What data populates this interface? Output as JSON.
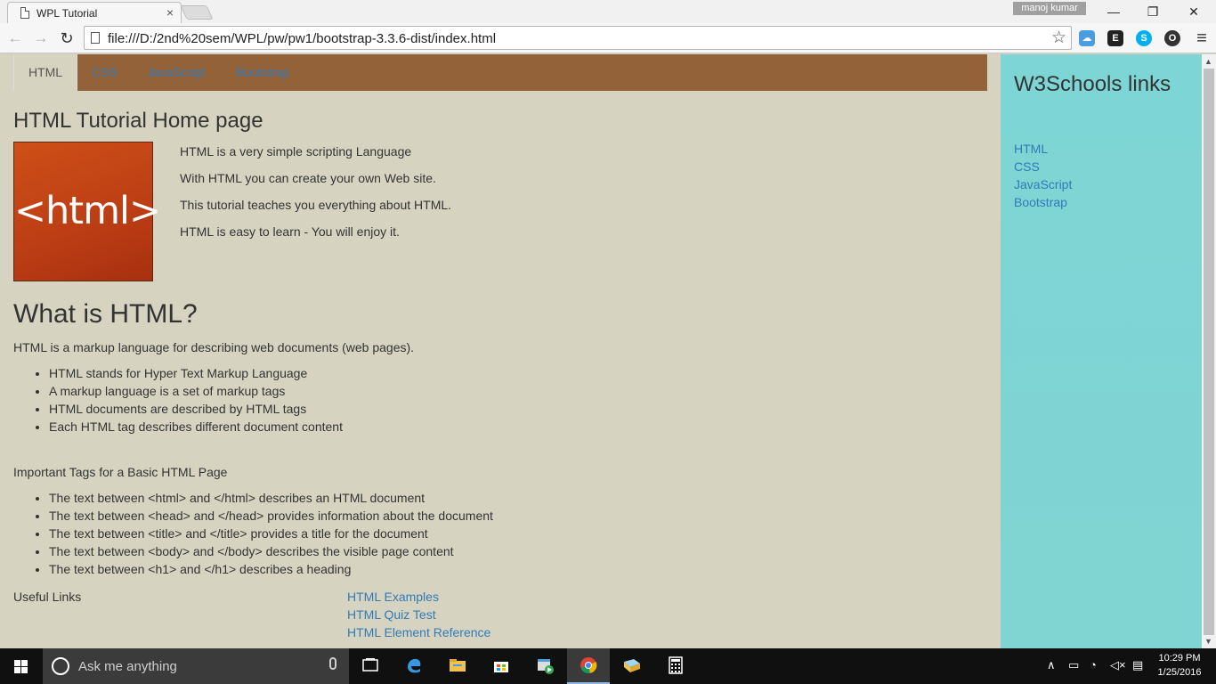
{
  "browser": {
    "tab_title": "WPL Tutorial",
    "tab_close": "×",
    "profile_name": "manoj kumar",
    "window_controls": {
      "minimize": "—",
      "restore": "❐",
      "close": "✕"
    },
    "back_icon": "←",
    "forward_icon": "→",
    "reload_icon": "↻",
    "url": "file:///D:/2nd%20sem/WPL/pw/pw1/bootstrap-3.3.6-dist/index.html",
    "star_icon": "☆",
    "menu_icon": "≡",
    "extensions": [
      "cloud-icon",
      "evernote-icon",
      "skype-icon",
      "opera-icon"
    ]
  },
  "nav": {
    "tabs": [
      {
        "label": "HTML",
        "active": true
      },
      {
        "label": "CSS",
        "active": false
      },
      {
        "label": "JavaScript",
        "active": false
      },
      {
        "label": "Bootstrap",
        "active": false
      }
    ]
  },
  "main": {
    "title": "HTML Tutorial Home page",
    "logo_text": "<html>",
    "intro": [
      "HTML is a very simple scripting Language",
      "With HTML you can create your own Web site.",
      "This tutorial teaches you everything about HTML.",
      "HTML is easy to learn - You will enjoy it."
    ],
    "whatis_heading": "What is HTML?",
    "whatis_para": "HTML is a markup language for describing web documents (web pages).",
    "whatis_list": [
      "HTML stands for Hyper Text Markup Language",
      "A markup language is a set of markup tags",
      "HTML documents are described by HTML tags",
      "Each HTML tag describes different document content"
    ],
    "tags_heading": "Important Tags for a Basic HTML Page",
    "tags_list": [
      "The text between <html> and </html> describes an HTML document",
      "The text between <head> and </head> provides information about the document",
      "The text between <title> and </title> provides a title for the document",
      "The text between <body> and </body> describes the visible page content",
      "The text between <h1> and </h1> describes a heading"
    ],
    "useful_label": "Useful Links",
    "useful_links": [
      "HTML Examples",
      "HTML Quiz Test",
      "HTML Element Reference"
    ]
  },
  "sidebar": {
    "title": "W3Schools links",
    "links": [
      "HTML",
      "CSS",
      "JavaScript",
      "Bootstrap"
    ]
  },
  "taskbar": {
    "search_placeholder": "Ask me anything",
    "apps": [
      "task-view-icon",
      "edge-icon",
      "file-explorer-icon",
      "store-icon",
      "media-icon",
      "chrome-icon",
      "folder-icon",
      "calculator-icon"
    ],
    "time": "10:29 PM",
    "date": "1/25/2016"
  },
  "colors": {
    "page_bg": "#d6d4c1",
    "navbar_bg": "#946239",
    "sidebar_bg": "#7dd5d5",
    "link": "#337ab7",
    "logo_orange": "#c4441a"
  }
}
